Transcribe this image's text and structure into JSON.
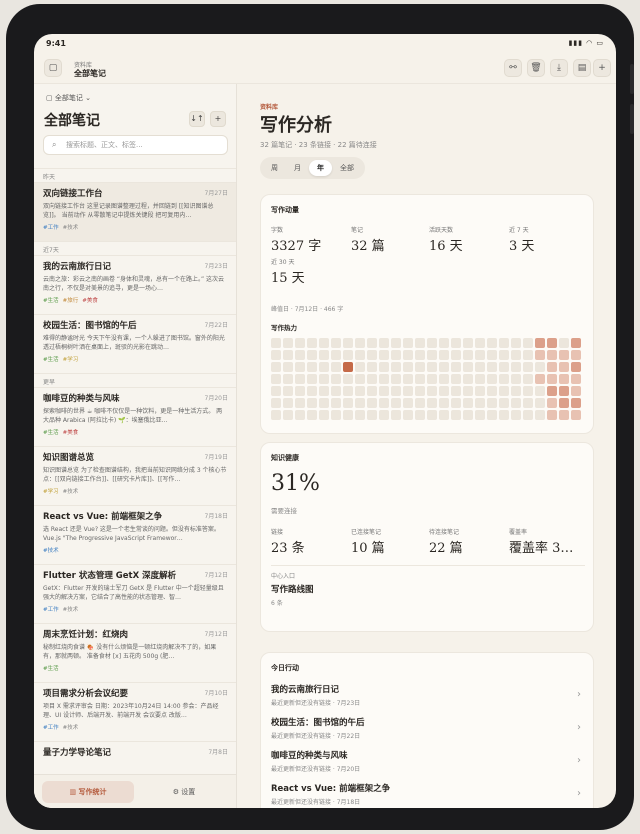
{
  "status": {
    "time": "9:41",
    "indicators": "▮▮▮ ◠ ▭"
  },
  "topbar": {
    "crumb_small": "资料库",
    "crumb_big": "全部笔记",
    "actions": [
      "share-icon",
      "trash-icon",
      "download-icon",
      "export-icon",
      "add-icon"
    ]
  },
  "sidebar": {
    "library_select": "▢  全部笔记 ⌄",
    "title": "全部笔记",
    "sort_label": "↓↑",
    "add_label": "+",
    "search_placeholder": "搜索标题、正文、标签...",
    "sections": [
      {
        "label": "昨天",
        "notes": [
          {
            "title": "双向链接工作台",
            "date": "7月27日",
            "excerpt": "双向链接工作台  这里记录图谱整理过程，并回链到 [[知识图谱总览]]。 当前动作  从零散笔记中提炼关键段 把可复用内…",
            "tags": [
              {
                "t": "#工作",
                "c": "#3f7fc2"
              },
              {
                "t": "#技术",
                "c": "#888888"
              }
            ]
          }
        ]
      },
      {
        "label": "近7天",
        "notes": [
          {
            "title": "我的云南旅行日记",
            "date": "7月23日",
            "excerpt": "云南之旅：彩云之南的画卷 “身体和灵魂，总有一个在路上。” 这次云南之行，不仅是对美景的追寻，更是一场心…",
            "tags": [
              {
                "t": "#生活",
                "c": "#5a9a4a"
              },
              {
                "t": "#旅行",
                "c": "#c28a3c"
              },
              {
                "t": "#美食",
                "c": "#c04a4a"
              }
            ]
          },
          {
            "title": "校园生活：图书馆的午后",
            "date": "7月22日",
            "excerpt": "难得的静谧时光  今天下午没有课，一个人躲进了图书馆。窗外的阳光透过梧桐树叶洒在桌面上，斑驳的光影在跳动…",
            "tags": [
              {
                "t": "#生活",
                "c": "#5a9a4a"
              },
              {
                "t": "#学习",
                "c": "#c2a23c"
              }
            ]
          }
        ]
      },
      {
        "label": "更早",
        "notes": [
          {
            "title": "咖啡豆的种类与风味",
            "date": "7月20日",
            "excerpt": "探索咖啡的世界 ☕  咖啡不仅仅是一种饮料，更是一种生活方式。 两大品种 Arabica (阿拉比卡) 🌱：埃塞俄比亚…",
            "tags": [
              {
                "t": "#生活",
                "c": "#5a9a4a"
              },
              {
                "t": "#美食",
                "c": "#c04a4a"
              }
            ]
          },
          {
            "title": "知识图谱总览",
            "date": "7月19日",
            "excerpt": "知识图谱总览  为了检查图谱结构，我把当前知识网络分成 3 个核心节点：[[双向链接工作台]]、[[研究卡片库]]、[[写作…",
            "tags": [
              {
                "t": "#学习",
                "c": "#c2a23c"
              },
              {
                "t": "#技术",
                "c": "#888888"
              }
            ]
          },
          {
            "title": "React vs Vue: 前端框架之争",
            "date": "7月18日",
            "excerpt": "选 React 还是 Vue?  这是一个老生常谈的问题。但没有标准答案。  Vue.js \"The Progressive JavaScript Framewor…",
            "tags": [
              {
                "t": "#技术",
                "c": "#3f7fc2"
              }
            ]
          },
          {
            "title": "Flutter 状态管理 GetX 深度解析",
            "date": "7月12日",
            "excerpt": "GetX：Flutter 开发的瑞士军刀  GetX 是 Flutter 中一个超轻量级且强大的解决方案，它结合了高性能的状态管理、智…",
            "tags": [
              {
                "t": "#工作",
                "c": "#3f7fc2"
              },
              {
                "t": "#技术",
                "c": "#888888"
              }
            ]
          },
          {
            "title": "周末烹饪计划：红烧肉",
            "date": "7月12日",
            "excerpt": "秘制红烧肉食谱 🍖  没有什么烦恼是一顿红烧肉解决不了的，如果有，那就两顿。  准备食材 [x] 五花肉 500g (肥…",
            "tags": [
              {
                "t": "#生活",
                "c": "#5a9a4a"
              }
            ]
          },
          {
            "title": "项目需求分析会议纪要",
            "date": "7月10日",
            "excerpt": "项目 X 需求评审会  日期：2023年10月24日 14:00 参会：产品经理、UI 设计师、后端开发、前端开发  会议要点 改版…",
            "tags": [
              {
                "t": "#工作",
                "c": "#3f7fc2"
              },
              {
                "t": "#技术",
                "c": "#888888"
              }
            ]
          },
          {
            "title": "量子力学导论笔记",
            "date": "7月8日",
            "excerpt": "",
            "tags": []
          }
        ]
      }
    ],
    "footer_tabs": [
      "写作统计",
      "设置"
    ]
  },
  "main": {
    "kicker": "资料库",
    "title": "写作分析",
    "subtitle": "32 篇笔记 · 23 条链接 · 22 篇待连接",
    "range_tabs": [
      "周",
      "月",
      "年",
      "全部"
    ],
    "active_range": "年",
    "momentum": {
      "heading": "写作动量",
      "stats": [
        {
          "label": "字数",
          "value": "3327 字"
        },
        {
          "label": "笔记",
          "value": "32 篇"
        },
        {
          "label": "活跃天数",
          "value": "16 天"
        },
        {
          "label": "近 7 天",
          "value": "3 天"
        },
        {
          "label": "近 30 天",
          "value": "15 天"
        }
      ],
      "peak": "峰值日 · 7月12日 · 466 字",
      "heatmap_label": "写作热力"
    },
    "health": {
      "heading": "知识健康",
      "percent": "31%",
      "percent_caption": "需要连接",
      "stats": [
        {
          "label": "链接",
          "value": "23 条"
        },
        {
          "label": "已连接笔记",
          "value": "10 篇"
        },
        {
          "label": "待连接笔记",
          "value": "22 篇"
        },
        {
          "label": "覆盖率",
          "value": "覆盖率 3…"
        }
      ],
      "entry_label": "中心入口",
      "entry_title": "写作路线图",
      "entry_sub": "6 条"
    },
    "activity": {
      "heading": "今日行动",
      "items": [
        {
          "title": "我的云南旅行日记",
          "sub": "最近更新但还没有链接 · 7月23日"
        },
        {
          "title": "校园生活：图书馆的午后",
          "sub": "最近更新但还没有链接 · 7月22日"
        },
        {
          "title": "咖啡豆的种类与风味",
          "sub": "最近更新但还没有链接 · 7月20日"
        },
        {
          "title": "React vs Vue: 前端框架之争",
          "sub": "最近更新但还没有链接 · 7月18日"
        },
        {
          "title": "Flutter 状态管理 GetX 深度解析",
          "sub": "最近更新但还没有链接 · 7月12日"
        }
      ]
    }
  },
  "colors": {
    "accent": "#b45a3c",
    "heat_empty": "#ece6dc",
    "heat_low": "#e8c2b2",
    "heat_mid": "#dca08a",
    "heat_high": "#c56a48"
  },
  "heatmap": {
    "weeks": 26,
    "days": 7,
    "levels": {
      "6,2": 3,
      "22,0": 2,
      "22,1": 1,
      "22,3": 1,
      "23,0": 2,
      "23,1": 1,
      "23,2": 1,
      "23,3": 1,
      "23,4": 2,
      "23,5": 1,
      "23,6": 1,
      "24,1": 1,
      "24,2": 1,
      "24,3": 1,
      "24,4": 2,
      "24,5": 2,
      "24,6": 1,
      "25,0": 2,
      "25,1": 1,
      "25,2": 2,
      "25,3": 1,
      "25,4": 1,
      "25,5": 2,
      "25,6": 1
    }
  }
}
